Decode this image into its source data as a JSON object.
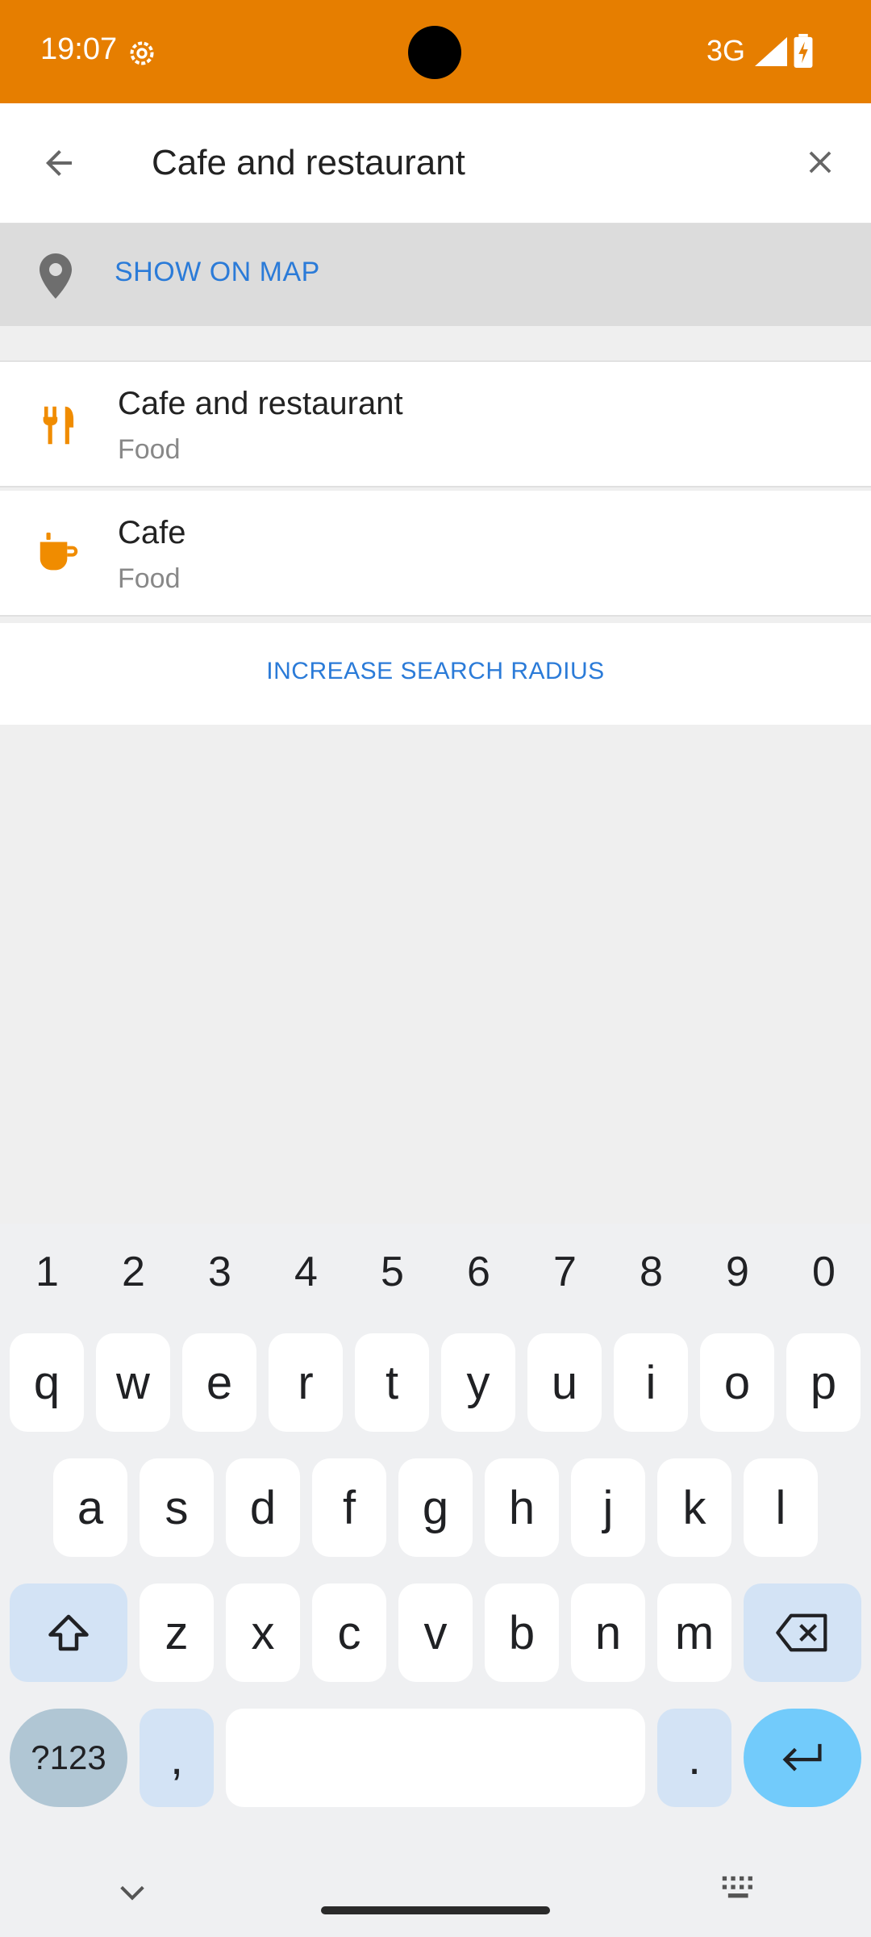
{
  "status_bar": {
    "time": "19:07",
    "network": "3G",
    "icons": [
      "settings-gear-icon",
      "camera-cutout",
      "signal-icon",
      "battery-charging-icon"
    ]
  },
  "search": {
    "query": "Cafe and restaurant",
    "back_icon": "arrow-left-icon",
    "clear_icon": "close-icon"
  },
  "show_on_map": {
    "label": "SHOW ON MAP",
    "icon": "map-pin-icon"
  },
  "results": [
    {
      "title": "Cafe and restaurant",
      "subtitle": "Food",
      "icon": "fork-knife-icon"
    },
    {
      "title": "Cafe",
      "subtitle": "Food",
      "icon": "coffee-cup-icon"
    }
  ],
  "increase_radius": {
    "label": "INCREASE SEARCH RADIUS"
  },
  "keyboard": {
    "numbers": [
      "1",
      "2",
      "3",
      "4",
      "5",
      "6",
      "7",
      "8",
      "9",
      "0"
    ],
    "row1": [
      "q",
      "w",
      "e",
      "r",
      "t",
      "y",
      "u",
      "i",
      "o",
      "p"
    ],
    "row2": [
      "a",
      "s",
      "d",
      "f",
      "g",
      "h",
      "j",
      "k",
      "l"
    ],
    "row3": [
      "z",
      "x",
      "c",
      "v",
      "b",
      "n",
      "m"
    ],
    "symbols_label": "?123",
    "comma_label": ",",
    "period_label": "."
  },
  "colors": {
    "status_bar": "#e67e00",
    "accent_link": "#2b7bd8",
    "icon_orange": "#f08c00",
    "enter_key": "#72cbfb"
  }
}
